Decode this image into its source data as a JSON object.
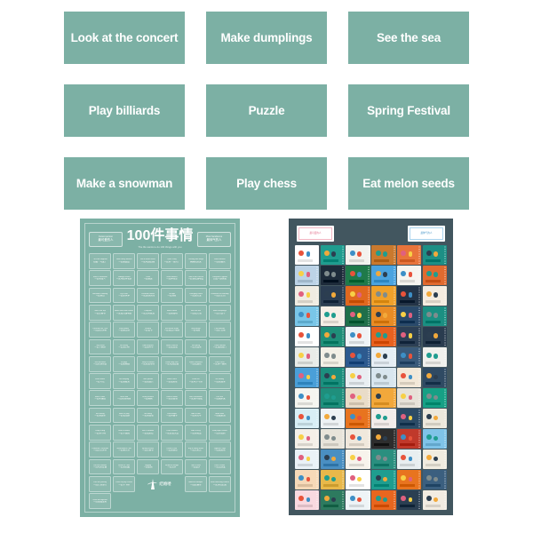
{
  "colors": {
    "card_teal": "#7cb0a4",
    "card_text": "#ffffff",
    "page_background": "#ffffff",
    "poster_left_background": "#7cb0a4",
    "poster_right_background": "#42565f",
    "accent_pink": "#e0607f",
    "accent_blue": "#3d8fc6"
  },
  "label_cards": [
    {
      "label": "Look at the concert"
    },
    {
      "label": "Make dumplings"
    },
    {
      "label": "See the sea"
    },
    {
      "label": "Play billiards"
    },
    {
      "label": "Puzzle"
    },
    {
      "label": "Spring Festival"
    },
    {
      "label": "Make a snowman"
    },
    {
      "label": "Play chess"
    },
    {
      "label": "Eat melon seeds"
    }
  ],
  "poster_left": {
    "title": "100件事情",
    "subtitle": "The life wants to do 100 things with you",
    "corner_left": {
      "en": "Cutest person",
      "cn": "最可爱的人"
    },
    "corner_right": {
      "en": "Most handsome",
      "cn": "最帅气的人"
    },
    "logo_text": "结婚喽",
    "cells": [
      {
        "en": "Pat cute neighbor",
        "cn": "拍摄「可爱」"
      },
      {
        "en": "Make fancy dessert",
        "cn": "一起做甜品"
      },
      {
        "en": "Eat a street snack",
        "cn": "一起吃路边摊"
      },
      {
        "en": "Open Party",
        "cn": "一起开「派对」"
      },
      {
        "en": "Painting and laugh",
        "cn": "画画和欢笑"
      },
      {
        "en": "Watch Aurora",
        "cn": "一起看极光"
      },
      {
        "en": "Make a snowman",
        "cn": "一起堆雪人"
      },
      {
        "en": "Midnight snack",
        "cn": "一起吃夜宵和酒"
      },
      {
        "en": "Cook",
        "cn": "一起做饭"
      },
      {
        "en": "Grow flowers",
        "cn": "一起种花草"
      },
      {
        "en": "Look at the concert",
        "cn": "一起去看演唱会"
      },
      {
        "en": "Complete a jigsaw",
        "cn": "完成一副拼图"
      },
      {
        "en": "Mountain climbing",
        "cn": "一起爬山"
      },
      {
        "en": "Fly a kite",
        "cn": "一起放风筝"
      },
      {
        "en": "Decorate house",
        "cn": "一起装饰房间"
      },
      {
        "en": "Fill night",
        "cn": "一起熬夜"
      },
      {
        "en": "Changing colors",
        "cn": "一起染头发"
      },
      {
        "en": "Celebrate our birthday",
        "cn": "一起过生日"
      },
      {
        "en": "New Year trip",
        "cn": "一起过春节"
      },
      {
        "en": "Watch films with sunset",
        "cn": "一起看日落电影"
      },
      {
        "en": "Campfire",
        "cn": "一起烧烤露营"
      },
      {
        "en": "Make coffee",
        "cn": "一起煮咖啡"
      },
      {
        "en": "See the sea",
        "cn": "一起看大海"
      },
      {
        "en": "Make dumplings",
        "cn": "一起包饺子"
      },
      {
        "en": "Decorate the Tree",
        "cn": "一起装圣诞树"
      },
      {
        "en": "Play football",
        "cn": "一起踢足球"
      },
      {
        "en": "Reading",
        "cn": "一起看书"
      },
      {
        "en": "Eat melon seeds",
        "cn": "一起嗑瓜子聊天"
      },
      {
        "en": "Sing songs",
        "cn": "一起唱歌"
      },
      {
        "en": "Play billiards",
        "cn": "一起打台球"
      },
      {
        "en": "Play chess",
        "cn": "一起下象棋"
      },
      {
        "en": "Go fishing",
        "cn": "一起去钓鱼"
      },
      {
        "en": "Ride bicycles",
        "cn": "一起骑单车"
      },
      {
        "en": "Watch sunrise",
        "cn": "一起看日出"
      },
      {
        "en": "Hot spring",
        "cn": "一起泡温泉"
      },
      {
        "en": "Travel abroad",
        "cn": "一起出国旅行"
      },
      {
        "en": "Visit museum",
        "cn": "一起逛博物馆"
      },
      {
        "en": "Do yoga",
        "cn": "一起做瑜伽"
      },
      {
        "en": "Shop in market",
        "cn": "一起逛菜市场"
      },
      {
        "en": "Feed stray cats",
        "cn": "一起喂流浪猫"
      },
      {
        "en": "Watch fireworks",
        "cn": "一起看烟花"
      },
      {
        "en": "Plant a tree",
        "cn": "一起种一棵树"
      },
      {
        "en": "Write letters",
        "cn": "一起写信"
      },
      {
        "en": "Go camping",
        "cn": "一起去露营"
      },
      {
        "en": "Take photos",
        "cn": "一起拍照片"
      },
      {
        "en": "Watch stars",
        "cn": "一起看星星"
      },
      {
        "en": "Drink tea",
        "cn": "一起喝下午茶"
      },
      {
        "en": "Go skating",
        "cn": "一起去滑冰"
      },
      {
        "en": "Bake a cake",
        "cn": "一起烤蛋糕"
      },
      {
        "en": "Go to zoo",
        "cn": "一起逛动物园"
      },
      {
        "en": "Draw pictures",
        "cn": "一起画画"
      },
      {
        "en": "Climb a tower",
        "cn": "一起登高塔"
      },
      {
        "en": "Run a marathon",
        "cn": "一起跑马拉松"
      },
      {
        "en": "Pick fruit",
        "cn": "一起摘水果"
      },
      {
        "en": "Sea diving",
        "cn": "一起去潜水"
      },
      {
        "en": "Watch a play",
        "cn": "一起看话剧"
      },
      {
        "en": "Go skiing",
        "cn": "一起去滑雪"
      },
      {
        "en": "Visit temple",
        "cn": "一起拜庙宇"
      },
      {
        "en": "Ride a train",
        "cn": "一起坐火车"
      },
      {
        "en": "Make wine",
        "cn": "一起酿果酒"
      },
      {
        "en": "Keep a dog",
        "cn": "一起养小狗"
      },
      {
        "en": "Learn a dance",
        "cn": "一起学跳舞"
      },
      {
        "en": "See a rainbow",
        "cn": "一起看彩虹"
      },
      {
        "en": "Catch fireflies",
        "cn": "一起捉萤火虫"
      },
      {
        "en": "Ride a ferry",
        "cn": "一起坐轮渡"
      },
      {
        "en": "Fold paper cranes",
        "cn": "一起折纸鹤"
      },
      {
        "en": "Celebrate Christmas",
        "cn": "一起过圣诞节"
      },
      {
        "en": "International Chat",
        "cn": "一起聊世界"
      },
      {
        "en": "Spring Festival",
        "cn": "一起过春节"
      },
      {
        "en": "Leave a note",
        "cn": "一起留便签"
      },
      {
        "en": "Buy a lottery ticket",
        "cn": "一起买彩票"
      },
      {
        "en": "Together Yoga",
        "cn": "一起做运动"
      },
      {
        "en": "Eat the rainbow",
        "cn": "一起吃彩虹糖"
      },
      {
        "en": "Dinner at Tibet",
        "cn": "一起去西藏"
      },
      {
        "en": "Jogging",
        "cn": "一起晨跑"
      },
      {
        "en": "Barbecue tonight",
        "cn": "一起烧烤"
      },
      {
        "en": "Take a walk",
        "cn": "一起散步"
      },
      {
        "en": "Love a friend",
        "cn": "一起交朋友"
      },
      {
        "en": "Plan the journey",
        "cn": "一起计划旅行"
      },
      {
        "en": "Learn to play Chess",
        "cn": "一起学下棋"
      },
      {
        "en": "",
        "cn": ""
      },
      {
        "en": "Attend a banquet",
        "cn": "一起赴婚宴"
      },
      {
        "en": "Wear matching clothes",
        "cn": "一起穿情侣装"
      },
      {
        "en": "Grow old together",
        "cn": "一起慢慢变老"
      }
    ]
  },
  "poster_right": {
    "corner_left": {
      "cn": "最可爱的人"
    },
    "corner_right": {
      "cn": "最帅气的人"
    },
    "illustration_palette": [
      "#ffffff",
      "#1f9d8f",
      "#f2f2ee",
      "#c9792e",
      "#e8743b",
      "#1d8f85",
      "#bcd3e6",
      "#1d2b3a",
      "#1f7a4a",
      "#4aa3df",
      "#f6f4ef",
      "#e06a2f",
      "#f0ece2",
      "#2b3d52",
      "#e0681f",
      "#f0a12a",
      "#243447",
      "#f4ece0",
      "#79c6e8",
      "#f5eee6",
      "#1f6f4a",
      "#e98c25",
      "#2a4a6b",
      "#1b8f82",
      "#ffffff",
      "#1f8f79",
      "#eef3f6",
      "#e8611f",
      "#2c3f55",
      "#2a3c4f",
      "#e8ece8",
      "#f3f0e6",
      "#2d5a8f",
      "#e6eef4",
      "#3a5a7a",
      "#f0f0ec",
      "#4a9fd8",
      "#1c8f7e",
      "#e8eef2",
      "#d8e6ef",
      "#f2e8d8",
      "#2f4a63",
      "#f5f5f0",
      "#1f8f7c",
      "#e9dcc8",
      "#f2a83b",
      "#e6e2d8",
      "#16a085",
      "#d8eef5",
      "#eef2f4",
      "#e8741f",
      "#f3edea",
      "#2b4b66",
      "#ece8dc",
      "#f4f0e8",
      "#e8e4da",
      "#f0e8dc",
      "#2d2d2d",
      "#c0392b",
      "#7fc3e8",
      "#eaf2f7",
      "#4a8fc2",
      "#f7f3ec",
      "#2a8f7f",
      "#e8eef0",
      "#f0ece0",
      "#f6d9b8",
      "#e8b84a",
      "#ffffff",
      "#1f9d8f",
      "#e8741f",
      "#3b5f7f",
      "#f9d9e0",
      "#2d7a5f",
      "#eef4f7",
      "#e8661f",
      "#2b3f52",
      "#f2ece2"
    ]
  }
}
